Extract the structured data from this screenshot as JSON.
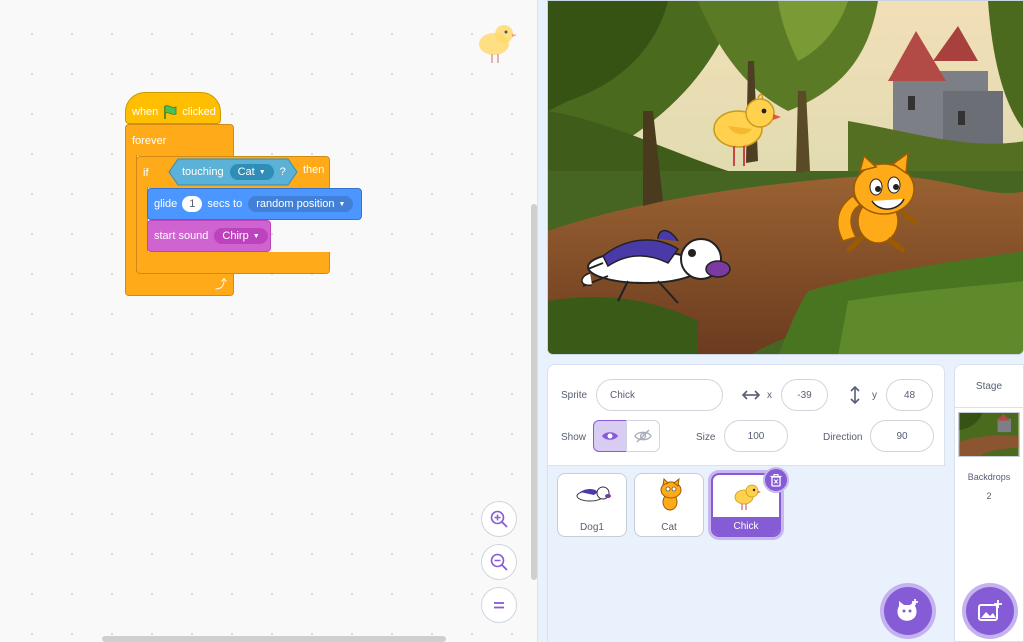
{
  "code": {
    "hat": {
      "when": "when",
      "clicked": "clicked"
    },
    "forever": "forever",
    "if_block": {
      "if": "if",
      "touching": "touching",
      "target": "Cat",
      "question": "?",
      "then": "then"
    },
    "glide": {
      "glide": "glide",
      "secs": "1",
      "secs_to": "secs to",
      "target": "random position"
    },
    "sound": {
      "label": "start sound",
      "value": "Chirp"
    },
    "zoom_icons": [
      "zoom-in-icon",
      "zoom-out-icon",
      "zoom-reset-icon"
    ]
  },
  "sprite_info": {
    "sprite_label": "Sprite",
    "sprite_name": "Chick",
    "x_label": "x",
    "x_value": "-39",
    "y_label": "y",
    "y_value": "48",
    "show_label": "Show",
    "size_label": "Size",
    "size_value": "100",
    "direction_label": "Direction",
    "direction_value": "90"
  },
  "sprites": [
    {
      "name": "Dog1",
      "selected": false
    },
    {
      "name": "Cat",
      "selected": false
    },
    {
      "name": "Chick",
      "selected": true
    }
  ],
  "stage_panel": {
    "title": "Stage",
    "backdrops_label": "Backdrops",
    "backdrops_count": "2"
  }
}
